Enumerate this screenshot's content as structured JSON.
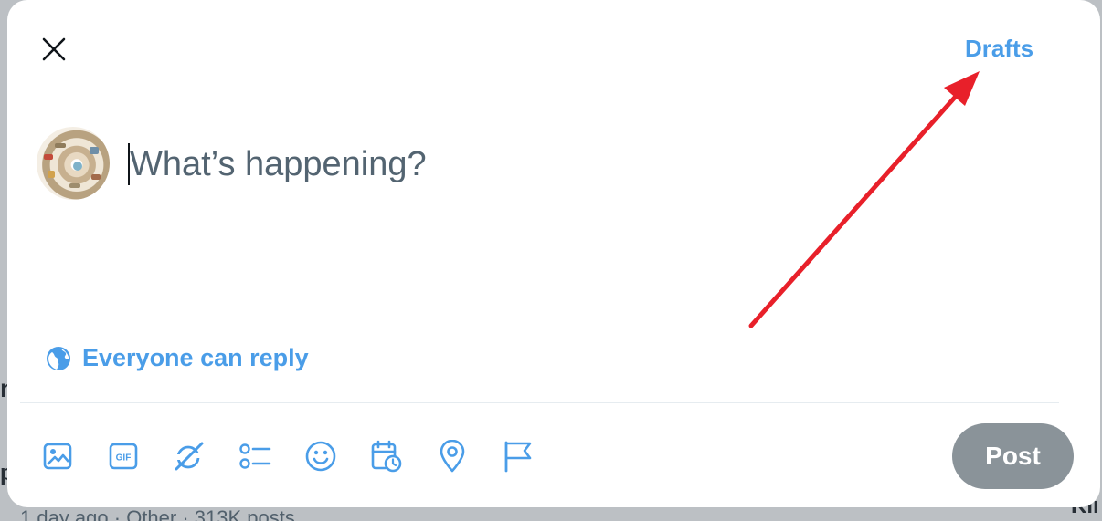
{
  "background": {
    "feed_meta": "1 day ago · Other · 313K posts",
    "right_fragment": "Kli",
    "left_fragment_1": "n",
    "left_fragment_2": "p"
  },
  "modal": {
    "close_icon": "close-icon",
    "drafts_label": "Drafts",
    "composer": {
      "placeholder": "What’s happening?",
      "value": ""
    },
    "reply_setting": {
      "icon": "globe-icon",
      "label": "Everyone can reply"
    },
    "toolbar": [
      {
        "icon": "image-icon"
      },
      {
        "icon": "gif-icon",
        "text": "GIF"
      },
      {
        "icon": "grok-icon"
      },
      {
        "icon": "poll-icon"
      },
      {
        "icon": "emoji-icon"
      },
      {
        "icon": "schedule-icon"
      },
      {
        "icon": "location-icon"
      },
      {
        "icon": "flag-icon"
      }
    ],
    "post_label": "Post"
  },
  "colors": {
    "accent": "#4a9de8",
    "post_disabled": "#8a9399",
    "placeholder": "#536471",
    "annotation_arrow": "#e8202a"
  }
}
